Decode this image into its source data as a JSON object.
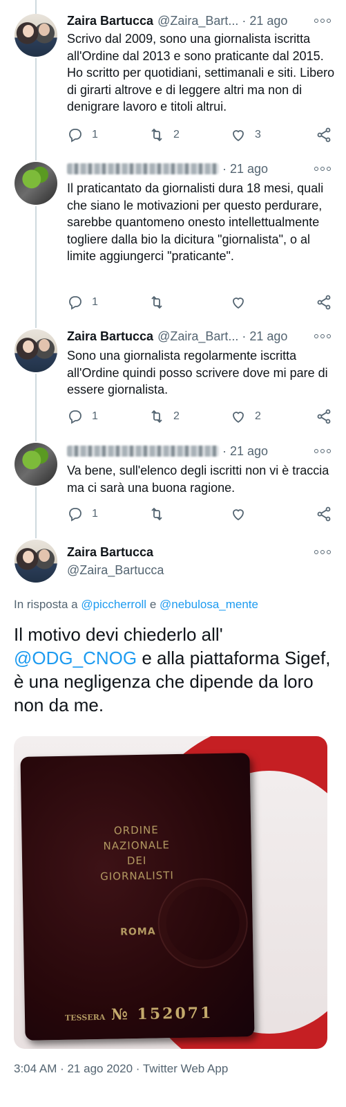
{
  "tweets": [
    {
      "name": "Zaira Bartucca",
      "handle": "@Zaira_Bart...",
      "time": "21 ago",
      "text": "Scrivo dal 2009, sono una giornalista iscritta all'Ordine dal 2013 e sono praticante dal 2015. Ho scritto per quotidiani, settimanali e siti. Libero di girarti altrove e di leggere altri ma non di denigrare lavoro e titoli altrui.",
      "replies": "1",
      "retweets": "2",
      "likes": "3"
    },
    {
      "name": "",
      "handle": "",
      "time": "21 ago",
      "text": "Il praticantato da giornalisti dura 18 mesi, quali che siano le motivazioni per questo perdurare, sarebbe quantomeno onesto intellettualmente togliere dalla bio la dicitura \"giornalista\", o al limite aggiungerci \"praticante\".",
      "replies": "1",
      "retweets": "",
      "likes": ""
    },
    {
      "name": "Zaira Bartucca",
      "handle": "@Zaira_Bart...",
      "time": "21 ago",
      "text": "Sono una giornalista regolarmente iscritta all'Ordine quindi posso scrivere dove mi pare di essere giornalista.",
      "replies": "1",
      "retweets": "2",
      "likes": "2"
    },
    {
      "name": "",
      "handle": "",
      "time": "21 ago",
      "text": "Va bene, sull'elenco degli iscritti non vi è traccia ma ci sarà una buona ragione.",
      "replies": "1",
      "retweets": "",
      "likes": ""
    }
  ],
  "main": {
    "name": "Zaira Bartucca",
    "handle": "@Zaira_Bartucca",
    "reply_prefix": "In risposta a",
    "reply_user1": "@piccherroll",
    "reply_and": "e",
    "reply_user2": "@nebulosa_mente",
    "text_part1": "Il motivo devi chiederlo all'",
    "text_mention": "@ODG_CNOG",
    "text_part2": "e alla piattaforma Sigef, è una negligenza che dipende da loro non da me.",
    "photo": {
      "line1": "ORDINE",
      "line2": "NAZIONALE",
      "line3": "DEI",
      "line4": "GIORNALISTI",
      "city": "ROMA",
      "tessera_label": "TESSERA",
      "tessera_number": "№ 152071"
    },
    "footer": "3:04 AM · 21 ago 2020 · Twitter Web App"
  },
  "colors": {
    "accent": "#1d9bf0",
    "muted": "#536471",
    "text": "#0f1419"
  }
}
